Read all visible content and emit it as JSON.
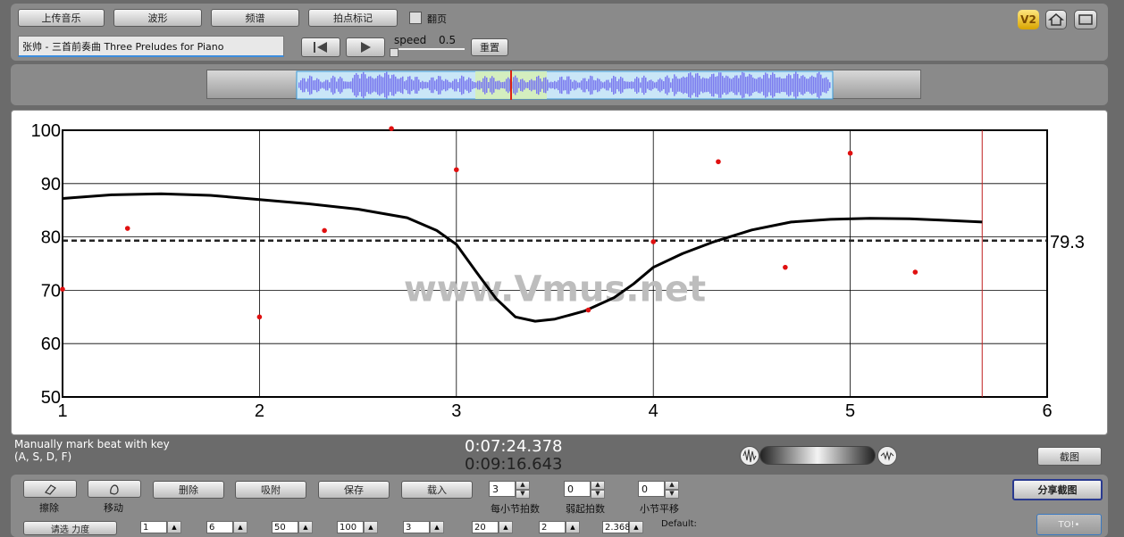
{
  "toolbar": {
    "upload_label": "上传音乐",
    "waveform_label": "波形",
    "spectrum_label": "频谱",
    "beat_mark_label": "拍点标记",
    "page_flip_label": "翻页",
    "track_title": "张帅 - 三首前奏曲 Three Preludes for Piano",
    "speed_label": "speed",
    "speed_value": "0.5",
    "reset_label": "重置",
    "version_badge": "V2"
  },
  "chart_data": {
    "type": "line",
    "x_ticks": [
      "1",
      "2",
      "3",
      "4",
      "5",
      "6"
    ],
    "y_ticks": [
      "100",
      "90",
      "80",
      "70",
      "60",
      "50"
    ],
    "xlim": [
      1,
      6
    ],
    "ylim": [
      50,
      100
    ],
    "grid": true,
    "average_value": 79.3,
    "average_label": "79.3",
    "cursor_x": 5.67,
    "watermark": "www.Vmus.net",
    "tempo_curve": [
      [
        1,
        87.2
      ],
      [
        1.25,
        87.9
      ],
      [
        1.5,
        88.1
      ],
      [
        1.75,
        87.8
      ],
      [
        2,
        87.0
      ],
      [
        2.25,
        86.2
      ],
      [
        2.5,
        85.2
      ],
      [
        2.75,
        83.6
      ],
      [
        2.9,
        81.2
      ],
      [
        3,
        78.6
      ],
      [
        3.1,
        73.5
      ],
      [
        3.2,
        68.5
      ],
      [
        3.3,
        65.0
      ],
      [
        3.4,
        64.2
      ],
      [
        3.5,
        64.6
      ],
      [
        3.65,
        66.1
      ],
      [
        3.8,
        68.6
      ],
      [
        3.9,
        71.2
      ],
      [
        4,
        74.3
      ],
      [
        4.15,
        76.9
      ],
      [
        4.3,
        79.0
      ],
      [
        4.5,
        81.3
      ],
      [
        4.7,
        82.8
      ],
      [
        4.9,
        83.3
      ],
      [
        5.1,
        83.5
      ],
      [
        5.3,
        83.4
      ],
      [
        5.5,
        83.1
      ],
      [
        5.67,
        82.8
      ]
    ],
    "points": [
      [
        1,
        70.2
      ],
      [
        1.33,
        81.6
      ],
      [
        2,
        65.0
      ],
      [
        2.33,
        81.2
      ],
      [
        2.67,
        100.3
      ],
      [
        3,
        92.6
      ],
      [
        3.67,
        66.3
      ],
      [
        4,
        79.1
      ],
      [
        4.33,
        94.1
      ],
      [
        4.67,
        74.3
      ],
      [
        5,
        95.7
      ],
      [
        5.33,
        73.4
      ]
    ]
  },
  "status": {
    "hint_line1": "Manually mark beat with key",
    "hint_line2": "(A, S, D, F)",
    "current_time": "0:07:24.378",
    "total_time": "0:09:16.643",
    "screenshot_label": "截图"
  },
  "controls": {
    "erase_label": "擦除",
    "move_label": "移动",
    "delete_label": "删除",
    "snap_label": "吸附",
    "save_label": "保存",
    "load_label": "载入",
    "beats_per_bar": "3",
    "beats_per_bar_label": "每小节拍数",
    "pickup_beats": "0",
    "pickup_beats_label": "弱起拍数",
    "bar_shift": "0",
    "bar_shift_label": "小节平移",
    "share_label": "分享截图",
    "bottom_button_label": "请选 力度",
    "bottom_values": [
      "1",
      "6",
      "50",
      "100",
      "3",
      "20",
      "2",
      "2.368"
    ],
    "default_label": "Default:"
  }
}
